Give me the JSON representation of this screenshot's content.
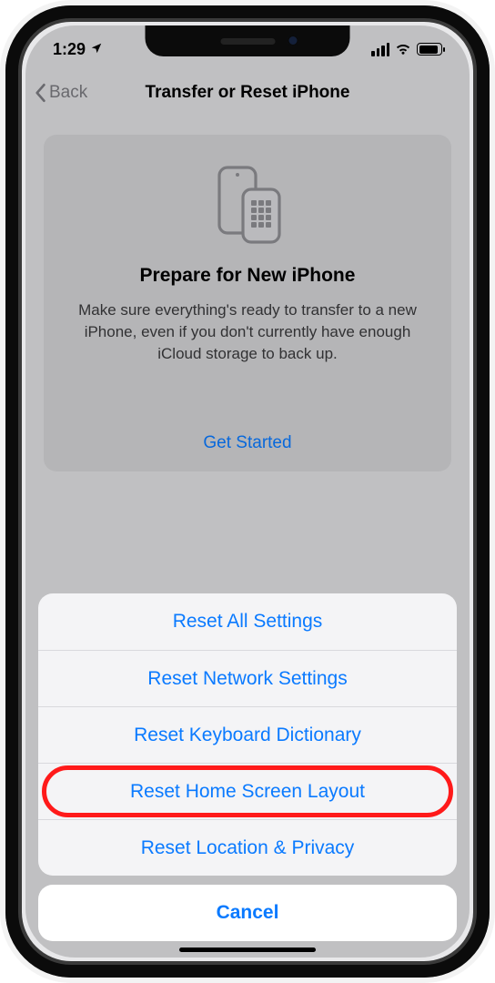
{
  "status": {
    "time": "1:29"
  },
  "nav": {
    "back": "Back",
    "title": "Transfer or Reset iPhone"
  },
  "card": {
    "heading": "Prepare for New iPhone",
    "body": "Make sure everything's ready to transfer to a new iPhone, even if you don't currently have enough iCloud storage to back up.",
    "cta": "Get Started"
  },
  "sheet": {
    "options": [
      "Reset All Settings",
      "Reset Network Settings",
      "Reset Keyboard Dictionary",
      "Reset Home Screen Layout",
      "Reset Location & Privacy"
    ],
    "cancel": "Cancel",
    "highlighted_index": 3
  }
}
